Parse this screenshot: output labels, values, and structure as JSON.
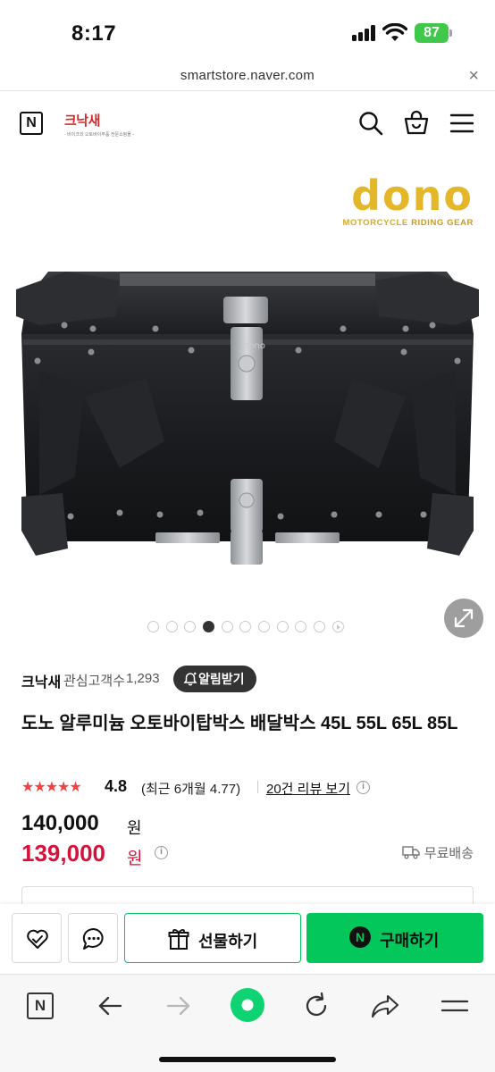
{
  "status_bar": {
    "time": "8:17",
    "battery": "87"
  },
  "url_bar": {
    "url": "smartstore.naver.com",
    "close_glyph": "×"
  },
  "header": {
    "n_logo": "N",
    "store_logo": "크낙새",
    "store_logo_tagline": "- 바이크와 오토바이부품 전문쇼핑몰 -",
    "icons": [
      "search-icon",
      "cart-icon",
      "menu-icon"
    ]
  },
  "product_image": {
    "brand_logo": "dono",
    "brand_tagline_a": "MOTORCYCLE ",
    "brand_tagline_b": "RIDING GEAR",
    "box_label": "dono",
    "slide_count": 11,
    "active_slide": 4
  },
  "store": {
    "name": "크낙새",
    "follower_label": "관심고객수",
    "follower_count": "1,293",
    "alarm_button": "알림받기"
  },
  "product": {
    "title": "도노 알루미늄 오토바이탑박스 배달박스 45L 55L 65L 85L",
    "stars": "★★★★★",
    "rating": "4.8",
    "recent_rating": "(최근 6개월 4.77)",
    "review_link": "20건 리뷰 보기",
    "info_glyph": "i",
    "original_price": "140,000",
    "sale_price": "139,000",
    "currency": "원",
    "shipping": "무료배송"
  },
  "actions": {
    "gift_button": "선물하기",
    "buy_button": "구매하기",
    "buy_badge": "N"
  },
  "browser_toolbar": {
    "n_label": "N",
    "items": [
      "naver-home-icon",
      "back-icon",
      "forward-icon",
      "green-dot-icon",
      "reload-icon",
      "share-icon",
      "more-menu-icon"
    ]
  },
  "colors": {
    "naver_green": "#03c75a",
    "sale_red": "#d6123a",
    "star_red": "#f04242",
    "brand_gold": "#e4b62a",
    "battery_green": "#3fc84a"
  }
}
